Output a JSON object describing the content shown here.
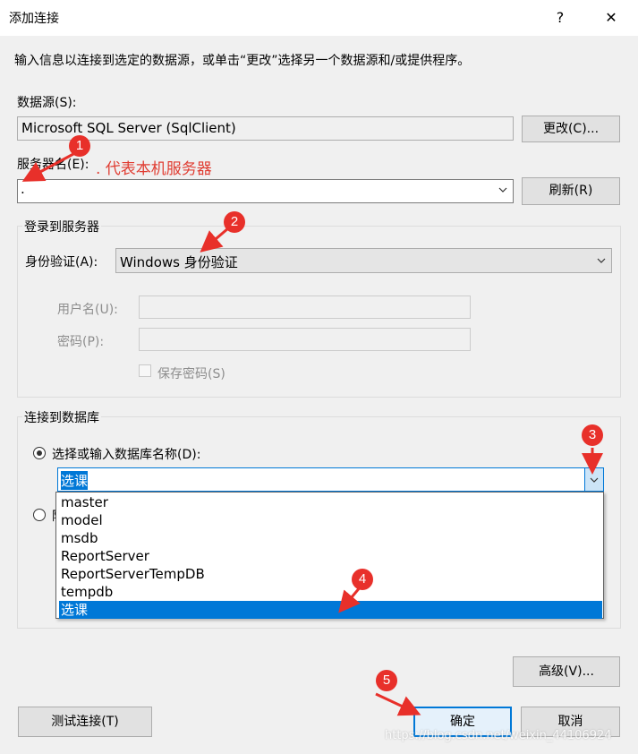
{
  "window": {
    "title": "添加连接",
    "help_glyph": "?",
    "close_glyph": "✕"
  },
  "description": "输入信息以连接到选定的数据源，或单击“更改”选择另一个数据源和/或提供程序。",
  "datasource": {
    "label": "数据源(S):",
    "value": "Microsoft SQL Server (SqlClient)",
    "change_button": "更改(C)..."
  },
  "server": {
    "label": "服务器名(E):",
    "value": ".",
    "refresh_button": "刷新(R)"
  },
  "annotation_text": ". 代表本机服务器",
  "login_group": {
    "legend": "登录到服务器",
    "auth_label": "身份验证(A):",
    "auth_value": "Windows 身份验证",
    "username_label": "用户名(U):",
    "password_label": "密码(P):",
    "save_password_label": "保存密码(S)"
  },
  "db_group": {
    "legend": "连接到数据库",
    "select_radio_label": "选择或输入数据库名称(D):",
    "db_input_value": "选课",
    "attach_radio_partial": "附",
    "db_options": [
      "master",
      "model",
      "msdb",
      "ReportServer",
      "ReportServerTempDB",
      "tempdb",
      "选课"
    ],
    "selected_option": "选课"
  },
  "buttons": {
    "advanced": "高级(V)...",
    "test": "测试连接(T)",
    "ok": "确定",
    "cancel": "取消"
  },
  "badges": [
    "1",
    "2",
    "3",
    "4",
    "5"
  ],
  "watermark": "https://blog.csdn.net/weixin_44106924",
  "colors": {
    "accent": "#0078d7",
    "badge": "#e8302a",
    "selection": "#0078d7"
  }
}
